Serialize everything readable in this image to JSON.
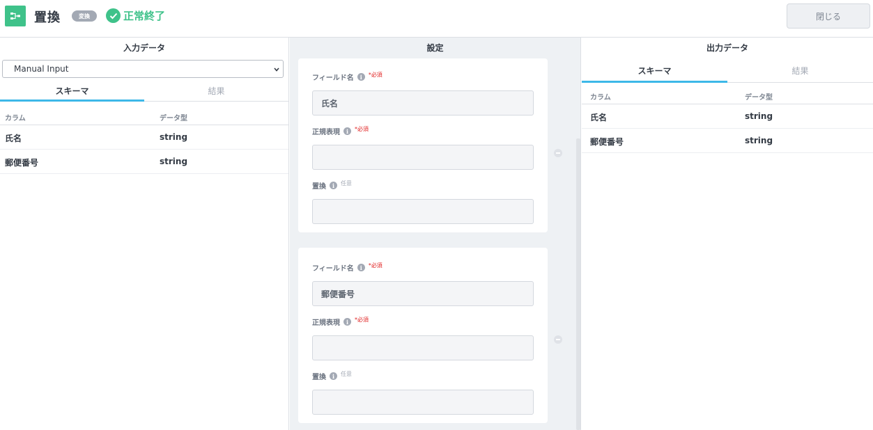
{
  "header": {
    "title": "置換",
    "badge": "変換",
    "status": "正常終了",
    "close_label": "閉じる",
    "logo_icon": "flow-node-icon",
    "status_icon": "check-circle-icon",
    "accent_color": "#3fc28a"
  },
  "input_panel": {
    "heading": "入力データ",
    "select_value": "Manual Input",
    "tabs": [
      "スキーマ",
      "結果"
    ],
    "active_tab": "スキーマ",
    "columns": [
      "カラム",
      "データ型"
    ],
    "rows": [
      {
        "column": "氏名",
        "type": "string"
      },
      {
        "column": "郵便番号",
        "type": "string"
      }
    ]
  },
  "settings_panel": {
    "heading": "設定",
    "cards": [
      {
        "field_label": "フィールド名",
        "field_req": "*必須",
        "field_value": "氏名",
        "regex_label": "正規表現",
        "regex_req": "*必須",
        "regex_value": "",
        "replace_label": "置換",
        "replace_opt": "任意",
        "replace_value": ""
      },
      {
        "field_label": "フィールド名",
        "field_req": "*必須",
        "field_value": "郵便番号",
        "regex_label": "正規表現",
        "regex_req": "*必須",
        "regex_value": "",
        "replace_label": "置換",
        "replace_opt": "任意",
        "replace_value": ""
      }
    ]
  },
  "output_panel": {
    "heading": "出力データ",
    "tabs": [
      "スキーマ",
      "結果"
    ],
    "active_tab": "スキーマ",
    "columns": [
      "カラム",
      "データ型"
    ],
    "rows": [
      {
        "column": "氏名",
        "type": "string"
      },
      {
        "column": "郵便番号",
        "type": "string"
      }
    ]
  }
}
